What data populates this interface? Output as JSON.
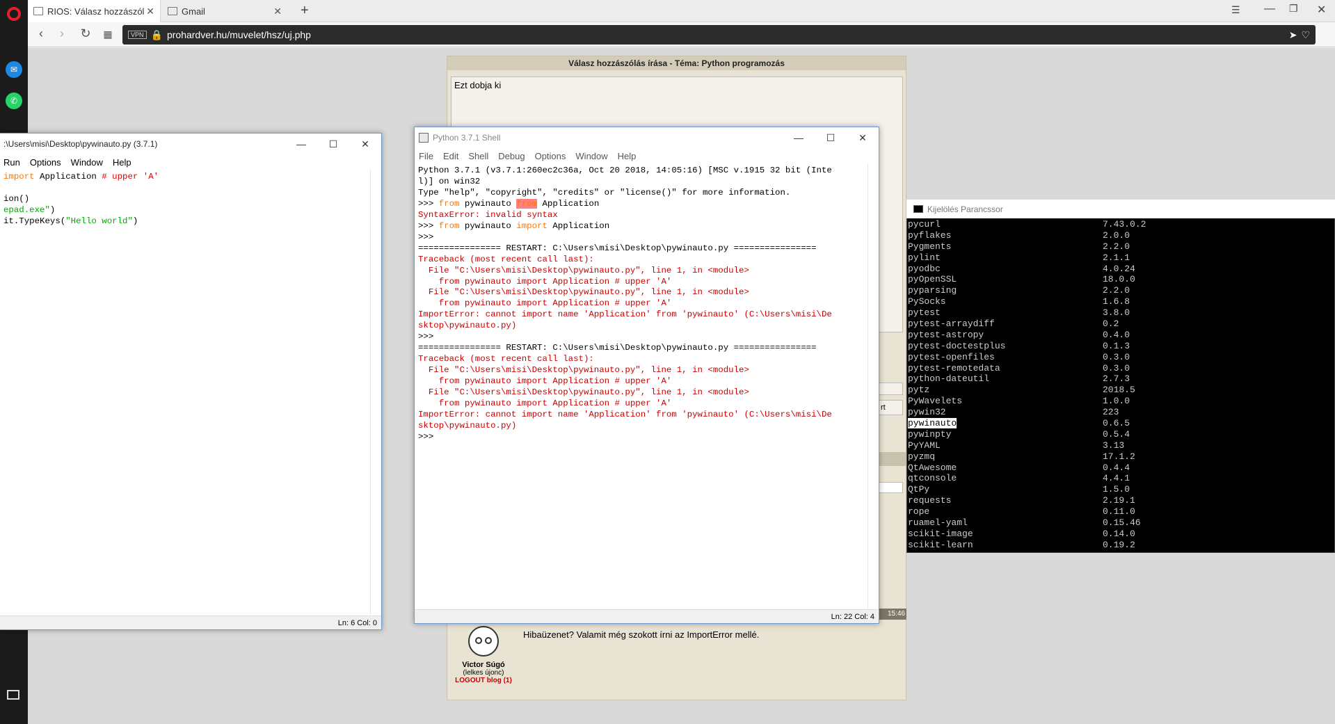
{
  "browser": {
    "tabs": [
      {
        "label": "RIOS: Válasz hozzászólás ír"
      },
      {
        "label": "Gmail"
      }
    ],
    "url": "prohardver.hu/muvelet/hsz/uj.php",
    "vpn": "VPN"
  },
  "page": {
    "panel_title": "Válasz hozzászólás írása - Téma: Python programozás",
    "reply_text": "Ezt dobja ki",
    "post_text": "Hibaüzenet? Valamit még szokott írni az ImportError mellé.",
    "post_time": "15:46",
    "author_name": "Victor Súgó",
    "author_rank": "(lelkes újonc)",
    "author_blog": "LOGOUT blog (1)",
    "side_btn": "rt"
  },
  "editor": {
    "title": ":\\Users\\misi\\Desktop\\pywinauto.py (3.7.1)",
    "menu": [
      "Run",
      "Options",
      "Window",
      "Help"
    ],
    "status": "Ln: 6   Col: 0"
  },
  "shell": {
    "title": "Python 3.7.1 Shell",
    "menu": [
      "File",
      "Edit",
      "Shell",
      "Debug",
      "Options",
      "Window",
      "Help"
    ],
    "status": "Ln: 22   Col: 4",
    "lines": [
      "Python 3.7.1 (v3.7.1:260ec2c36a, Oct 20 2018, 14:05:16) [MSC v.1915 32 bit (Inte",
      "l)] on win32",
      "Type \"help\", \"copyright\", \"credits\" or \"license()\" for more information.",
      "SyntaxError: invalid syntax",
      "================ RESTART: C:\\Users\\misi\\Desktop\\pywinauto.py ================",
      "Traceback (most recent call last):",
      "  File \"C:\\Users\\misi\\Desktop\\pywinauto.py\", line 1, in <module>",
      "    from pywinauto import Application # upper 'A'",
      "ImportError: cannot import name 'Application' from 'pywinauto' (C:\\Users\\misi\\De",
      "sktop\\pywinauto.py)"
    ]
  },
  "cmd": {
    "title": "Kijelölés Parancssor",
    "packages": [
      [
        "pycurl",
        "7.43.0.2"
      ],
      [
        "pyflakes",
        "2.0.0"
      ],
      [
        "Pygments",
        "2.2.0"
      ],
      [
        "pylint",
        "2.1.1"
      ],
      [
        "pyodbc",
        "4.0.24"
      ],
      [
        "pyOpenSSL",
        "18.0.0"
      ],
      [
        "pyparsing",
        "2.2.0"
      ],
      [
        "PySocks",
        "1.6.8"
      ],
      [
        "pytest",
        "3.8.0"
      ],
      [
        "pytest-arraydiff",
        "0.2"
      ],
      [
        "pytest-astropy",
        "0.4.0"
      ],
      [
        "pytest-doctestplus",
        "0.1.3"
      ],
      [
        "pytest-openfiles",
        "0.3.0"
      ],
      [
        "pytest-remotedata",
        "0.3.0"
      ],
      [
        "python-dateutil",
        "2.7.3"
      ],
      [
        "pytz",
        "2018.5"
      ],
      [
        "PyWavelets",
        "1.0.0"
      ],
      [
        "pywin32",
        "223"
      ],
      [
        "pywinauto",
        "0.6.5"
      ],
      [
        "pywinpty",
        "0.5.4"
      ],
      [
        "PyYAML",
        "3.13"
      ],
      [
        "pyzmq",
        "17.1.2"
      ],
      [
        "QtAwesome",
        "0.4.4"
      ],
      [
        "qtconsole",
        "4.4.1"
      ],
      [
        "QtPy",
        "1.5.0"
      ],
      [
        "requests",
        "2.19.1"
      ],
      [
        "rope",
        "0.11.0"
      ],
      [
        "ruamel-yaml",
        "0.15.46"
      ],
      [
        "scikit-image",
        "0.14.0"
      ],
      [
        "scikit-learn",
        "0.19.2"
      ]
    ]
  },
  "colors": {
    "accent": "#6f9ad1",
    "error": "#c00000"
  }
}
